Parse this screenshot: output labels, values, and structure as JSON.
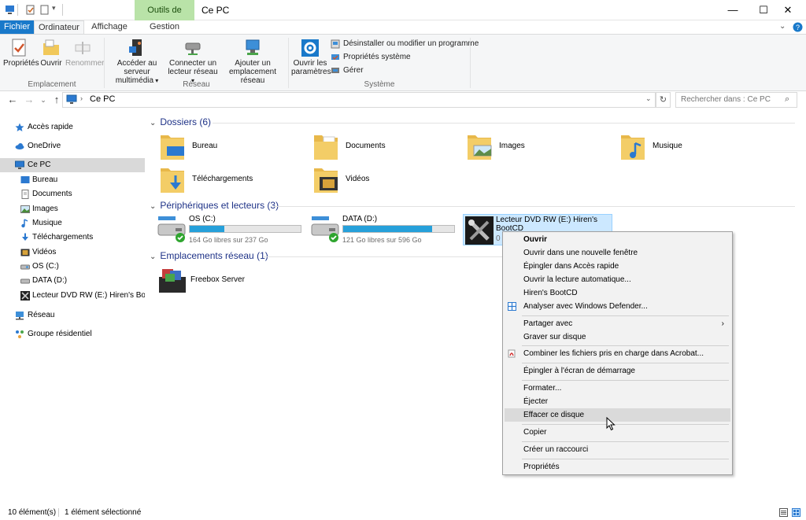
{
  "window": {
    "title": "Ce PC",
    "context_tab_header": "Outils de lecteur",
    "controls": {
      "minimize": "—",
      "maximize": "☐",
      "close": "✕"
    }
  },
  "ribbon_tabs": [
    "Fichier",
    "Ordinateur",
    "Affichage",
    "Gestion"
  ],
  "ribbon": {
    "groups": [
      {
        "label": "Emplacement",
        "buttons": [
          "Propriétés",
          "Ouvrir",
          "Renommer"
        ]
      },
      {
        "label": "Réseau",
        "buttons": [
          "Accéder au serveur multimédia",
          "Connecter un lecteur réseau",
          "Ajouter un emplacement réseau"
        ]
      },
      {
        "label": "Système",
        "buttons": [
          "Ouvrir les paramètres"
        ],
        "small_buttons": [
          "Désinstaller ou modifier un programme",
          "Propriétés système",
          "Gérer"
        ]
      }
    ],
    "btn_lines": {
      "acceder_1": "Accéder au serveur",
      "acceder_2": "multimédia",
      "connecter_1": "Connecter un",
      "connecter_2": "lecteur réseau",
      "ajouter_1": "Ajouter un",
      "ajouter_2": "emplacement réseau",
      "parametres_1": "Ouvrir les",
      "parametres_2": "paramètres"
    }
  },
  "address": {
    "path": "Ce PC",
    "search_placeholder": "Rechercher dans : Ce PC"
  },
  "nav": [
    {
      "label": "Accès rapide",
      "icon": "star-icon"
    },
    {
      "label": "OneDrive",
      "icon": "cloud-icon"
    },
    {
      "label": "Ce PC",
      "icon": "computer-icon",
      "selected": true
    },
    {
      "label": "Bureau",
      "icon": "desktop-icon"
    },
    {
      "label": "Documents",
      "icon": "documents-icon"
    },
    {
      "label": "Images",
      "icon": "images-icon"
    },
    {
      "label": "Musique",
      "icon": "music-icon"
    },
    {
      "label": "Téléchargements",
      "icon": "download-icon"
    },
    {
      "label": "Vidéos",
      "icon": "video-icon"
    },
    {
      "label": "OS (C:)",
      "icon": "drive-icon"
    },
    {
      "label": "DATA (D:)",
      "icon": "drive-icon"
    },
    {
      "label": "Lecteur DVD RW (E:) Hiren's BootCD",
      "icon": "tools-icon"
    },
    {
      "label": "Réseau",
      "icon": "network-icon"
    },
    {
      "label": "Groupe résidentiel",
      "icon": "homegroup-icon"
    }
  ],
  "sections": {
    "folders": "Dossiers (6)",
    "devices": "Périphériques et lecteurs (3)",
    "network": "Emplacements réseau (1)"
  },
  "folders": [
    "Bureau",
    "Documents",
    "Images",
    "Musique",
    "Téléchargements",
    "Vidéos"
  ],
  "drives": [
    {
      "name": "OS (C:)",
      "free": "164 Go libres sur 237 Go",
      "used_fraction": 0.31
    },
    {
      "name": "DATA (D:)",
      "free": "121 Go libres sur 596 Go",
      "used_fraction": 0.8
    },
    {
      "name_line1": "Lecteur DVD RW (E:) Hiren's",
      "name_line2": "BootCD",
      "free_partial": "0"
    }
  ],
  "network_locations": [
    "Freebox Server"
  ],
  "context_menu": [
    "Ouvrir",
    "Ouvrir dans une nouvelle fenêtre",
    "Épingler dans Accès rapide",
    "Ouvrir la lecture automatique...",
    "Hiren's BootCD",
    "Analyser avec Windows Defender...",
    "Partager avec",
    "Graver sur disque",
    "Combiner les fichiers pris en charge dans Acrobat...",
    "Épingler à l'écran de démarrage",
    "Formater...",
    "Éjecter",
    "Effacer ce disque",
    "Copier",
    "Créer un raccourci",
    "Propriétés"
  ],
  "status": {
    "count": "10 élément(s)",
    "selected": "1 élément sélectionné"
  },
  "colors": {
    "accent": "#1979ca",
    "context_tab": "#b9e3a8",
    "selection": "#cce8ff",
    "drive_bar": "#26a0da",
    "section_text": "#1e3287"
  }
}
